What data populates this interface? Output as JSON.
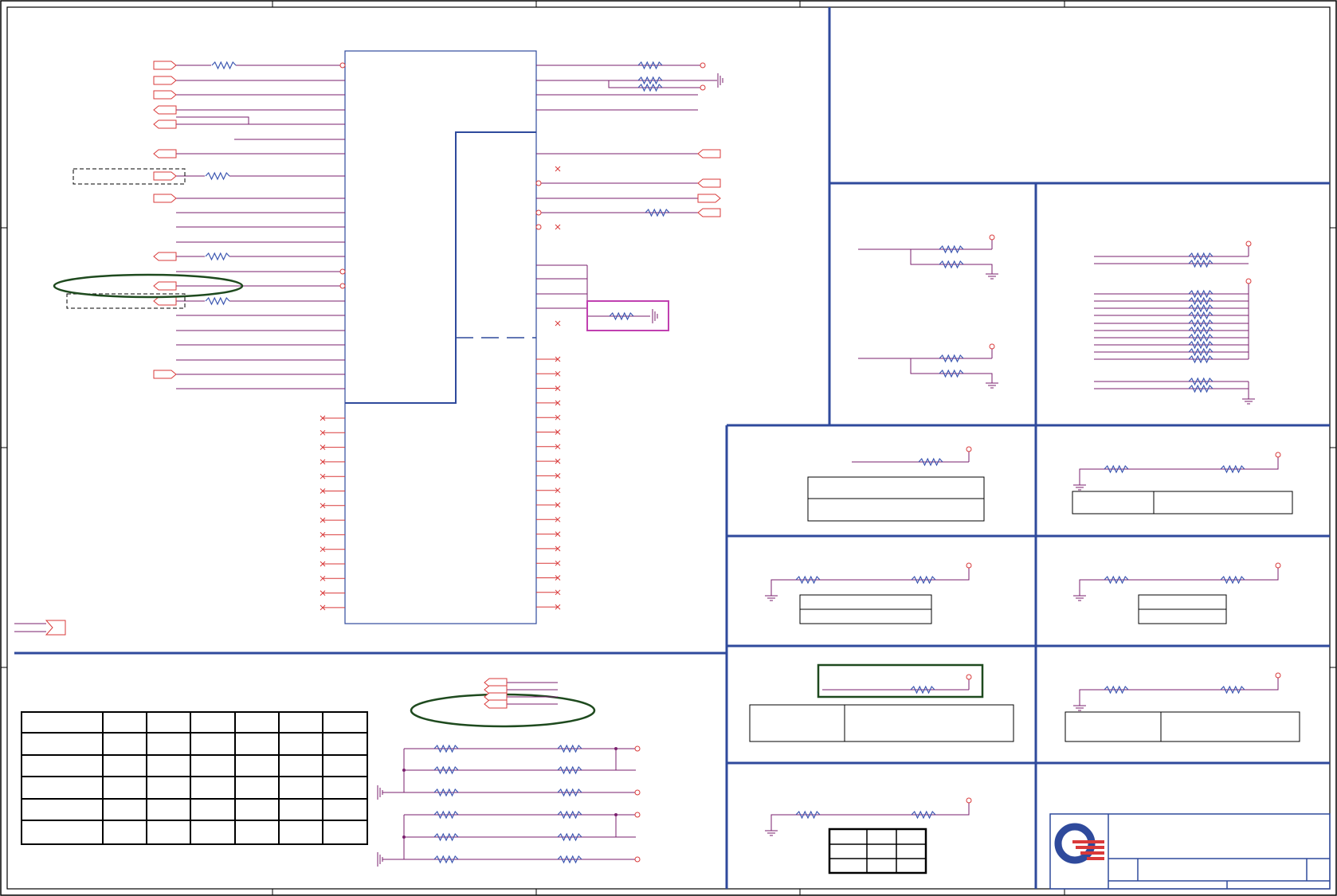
{
  "sheet": {
    "title": "",
    "colors": {
      "border": "#000000",
      "zone_line": "#2f4a9c",
      "wire": "#d93a3a",
      "net": "#7a1f6e",
      "resistor": "#3a55b0",
      "ic_outline": "#2f4a9c",
      "highlight_ellipse": "#1e4a1e",
      "highlight_box_green": "#1e4a1e",
      "highlight_box_magenta": "#c040b0",
      "dashed_box": "#000000",
      "logo_blue": "#2f4a9c",
      "logo_red": "#d93a3a"
    }
  },
  "icons": {
    "logo": "company-logo-icon",
    "ground": "ground-icon",
    "resistor": "resistor-icon",
    "no_connect": "no-connect-icon",
    "offpage": "offpage-connector-icon",
    "terminal": "terminal-icon"
  },
  "title_block": {
    "logo": "logo"
  }
}
